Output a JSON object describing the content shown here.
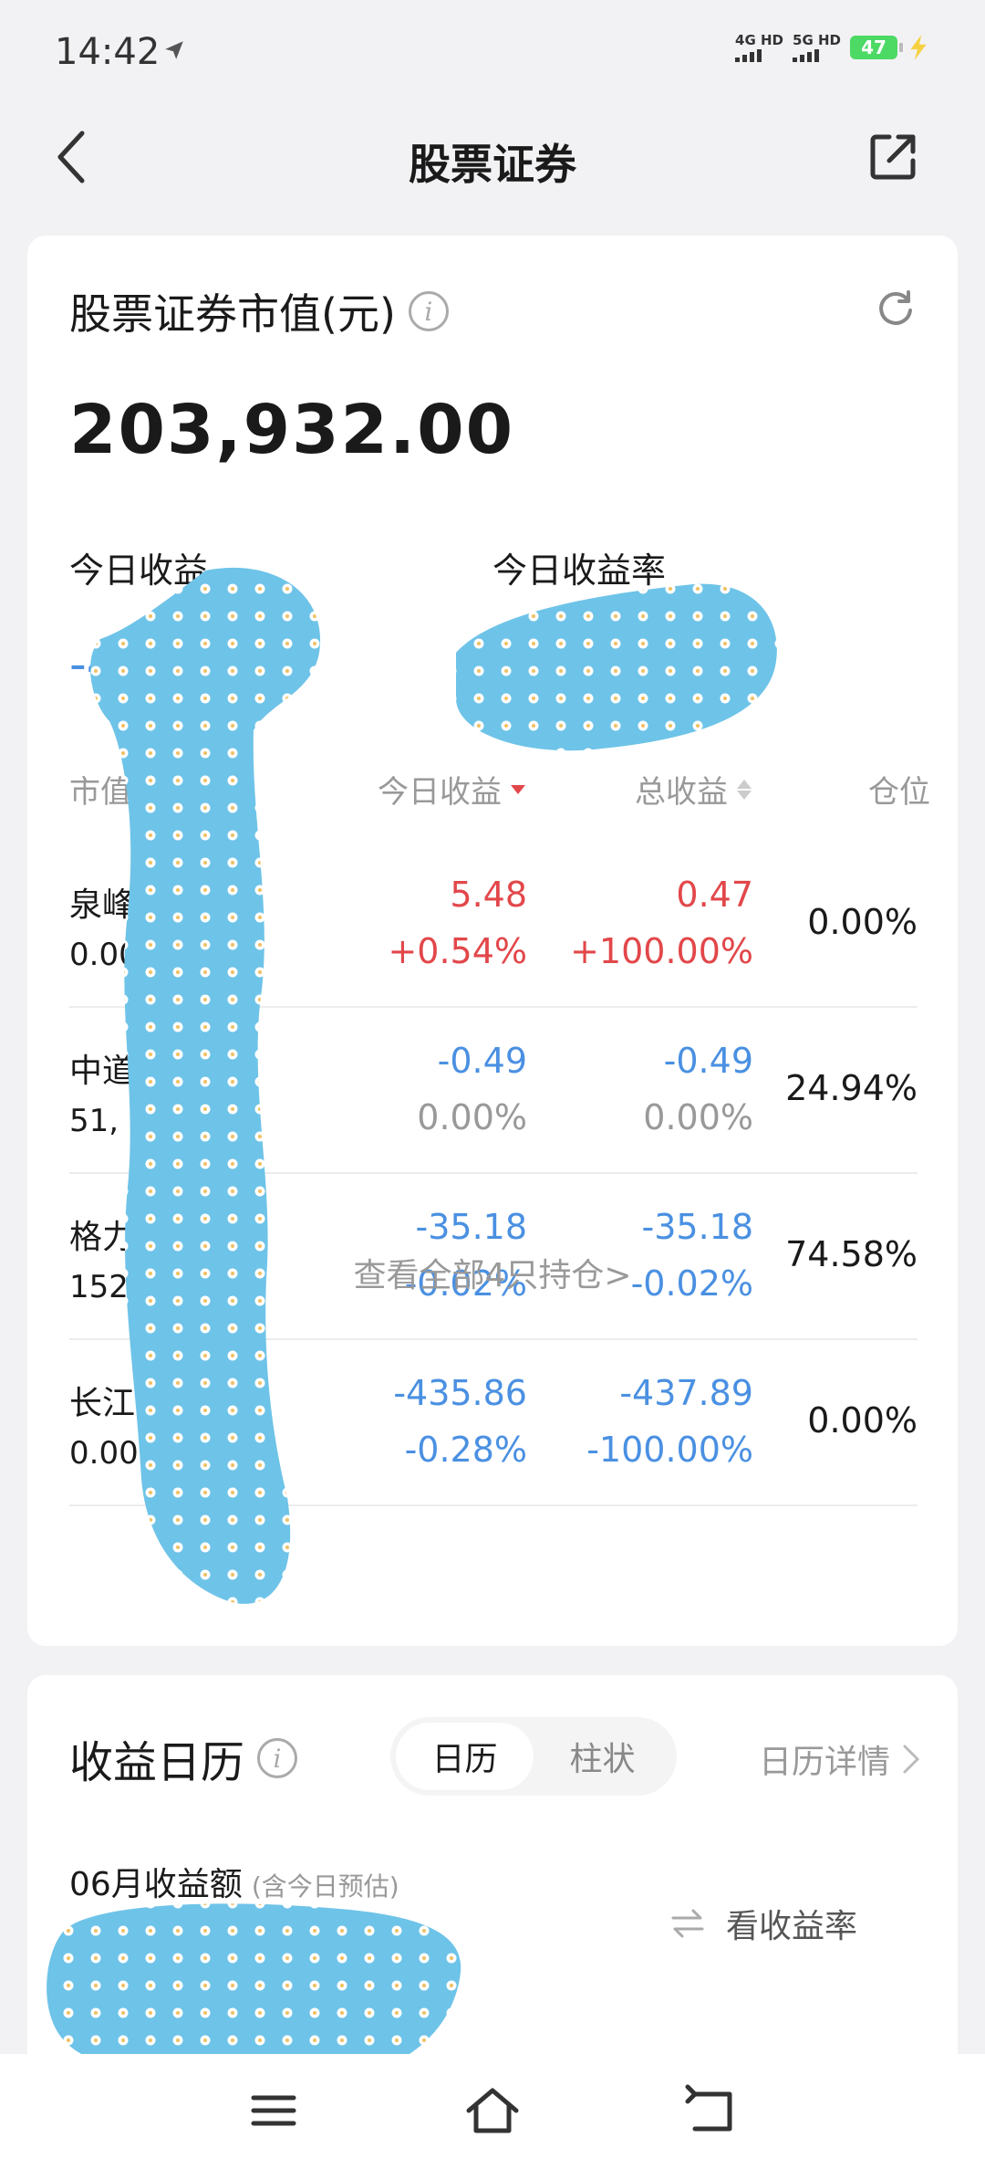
{
  "status_bar": {
    "time": "14:42",
    "signal1": "4G HD",
    "signal2": "5G HD",
    "battery": "47"
  },
  "header": {
    "title": "股票证券"
  },
  "market_value": {
    "title": "股票证券市值(元)",
    "value": "203,932.00",
    "today_profit_label": "今日收益",
    "today_profit_value": "-4",
    "today_rate_label": "今日收益率"
  },
  "table": {
    "col_market": "市值",
    "col_today": "今日收益",
    "col_total": "总收益",
    "col_position": "仓位",
    "rows": [
      {
        "name": "泉峰",
        "sub": "0.00",
        "today": "5.48",
        "today_pct": "+0.54%",
        "total": "0.47",
        "total_pct": "+100.00%",
        "position": "0.00%"
      },
      {
        "name": "中道",
        "sub": "51,",
        "today": "-0.49",
        "today_pct": "0.00%",
        "total": "-0.49",
        "total_pct": "0.00%",
        "position": "24.94%"
      },
      {
        "name": "格力",
        "sub": "152",
        "today": "-35.18",
        "today_pct": "-0.02%",
        "total": "-35.18",
        "total_pct": "-0.02%",
        "position": "74.58%"
      },
      {
        "name": "长江",
        "sub": "0.00",
        "today": "-435.86",
        "today_pct": "-0.28%",
        "total": "-437.89",
        "total_pct": "-100.00%",
        "position": "0.00%"
      }
    ],
    "view_all": "查看全部4只持仓>"
  },
  "calendar": {
    "title": "收益日历",
    "tab_calendar": "日历",
    "tab_bar": "柱状",
    "detail": "日历详情",
    "month_label": "06月收益额",
    "month_note": "(含今日预估)",
    "see_rate": "看收益率"
  },
  "colors": {
    "profit_red": "#e2474a",
    "loss_blue": "#4a90e2",
    "redaction": "#6ec3e8"
  }
}
